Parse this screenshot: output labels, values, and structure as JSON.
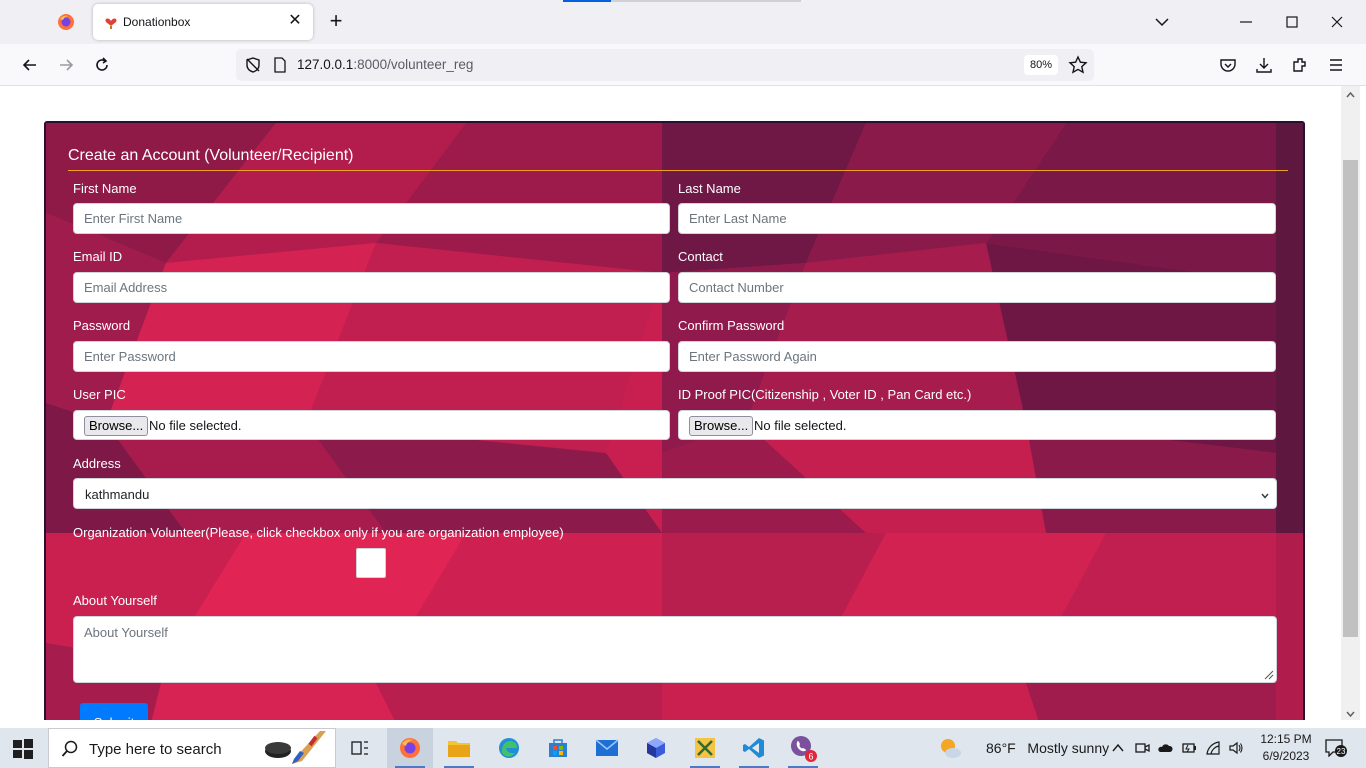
{
  "browser": {
    "tab_title": "Donationbox",
    "url_host": "127.0.0.1",
    "url_path": ":8000/volunteer_reg",
    "zoom": "80%"
  },
  "form": {
    "title": "Create an Account (Volunteer/Recipient)",
    "first_name": {
      "label": "First Name",
      "placeholder": "Enter First Name"
    },
    "last_name": {
      "label": "Last Name",
      "placeholder": "Enter Last Name"
    },
    "email": {
      "label": "Email ID",
      "placeholder": "Email Address"
    },
    "contact": {
      "label": "Contact",
      "placeholder": "Contact Number"
    },
    "password": {
      "label": "Password",
      "placeholder": "Enter Password"
    },
    "confirm_password": {
      "label": "Confirm Password",
      "placeholder": "Enter Password Again"
    },
    "user_pic": {
      "label": "User PIC",
      "button": "Browse...",
      "status": "No file selected."
    },
    "id_proof": {
      "label": "ID Proof PIC(Citizenship , Voter ID , Pan Card etc.)",
      "button": "Browse...",
      "status": "No file selected."
    },
    "address": {
      "label": "Address",
      "value": "kathmandu"
    },
    "organization": {
      "label": "Organization Volunteer(Please, click checkbox only if you are organization employee)",
      "checked": false
    },
    "about": {
      "label": "About Yourself",
      "placeholder": "About Yourself"
    },
    "submit_label": "Submit"
  },
  "taskbar": {
    "search_placeholder": "Type here to search",
    "weather_temp": "86°F",
    "weather_desc": "Mostly sunny",
    "time": "12:15 PM",
    "date": "6/9/2023",
    "mail_badge": "6",
    "notification_count": "23"
  },
  "colors": {
    "card_background": "#c21d4f",
    "title_rule": "#f0a020",
    "submit_button": "#007bff"
  }
}
